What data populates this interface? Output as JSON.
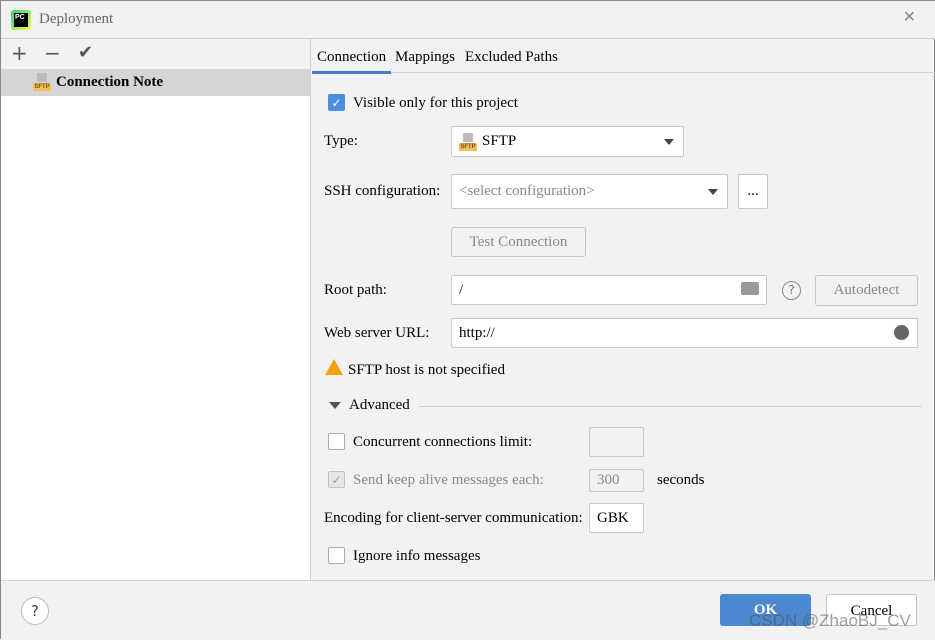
{
  "window": {
    "title": "Deployment"
  },
  "sidebar": {
    "toolbar": {
      "add": "+",
      "remove": "−",
      "apply": "✔"
    },
    "items": [
      {
        "label": "Connection Note",
        "icon": "sftp-warning-icon"
      }
    ]
  },
  "tabs": [
    {
      "label": "Connection",
      "active": true
    },
    {
      "label": "Mappings"
    },
    {
      "label": "Excluded Paths"
    }
  ],
  "form": {
    "visible_only": {
      "label": "Visible only for this project",
      "checked": true
    },
    "type": {
      "label": "Type:",
      "value": "SFTP"
    },
    "ssh": {
      "label": "SSH configuration:",
      "placeholder": "<select configuration>",
      "more": "..."
    },
    "test_connection": "Test Connection",
    "root_path": {
      "label": "Root path:",
      "value": "/",
      "help": "?",
      "autodetect": "Autodetect"
    },
    "web_url": {
      "label": "Web server URL:",
      "value": "http://"
    },
    "warning": "SFTP host is not specified",
    "advanced": {
      "label": "Advanced",
      "concurrent": {
        "label": "Concurrent connections limit:",
        "checked": false,
        "value": ""
      },
      "keep_alive": {
        "label": "Send keep alive messages each:",
        "checked": true,
        "disabled": true,
        "value": "300",
        "unit": "seconds"
      },
      "encoding": {
        "label": "Encoding for client-server communication:",
        "value": "GBK"
      },
      "ignore_info": {
        "label": "Ignore info messages",
        "checked": false
      }
    }
  },
  "footer": {
    "help": "?",
    "ok": "OK",
    "cancel": "Cancel"
  },
  "watermark": "CSDN @ZhaoBJ_CV",
  "colors": {
    "accent": "#3d7dca",
    "ok_button": "#4a88cf",
    "warning": "#f0a30a"
  }
}
